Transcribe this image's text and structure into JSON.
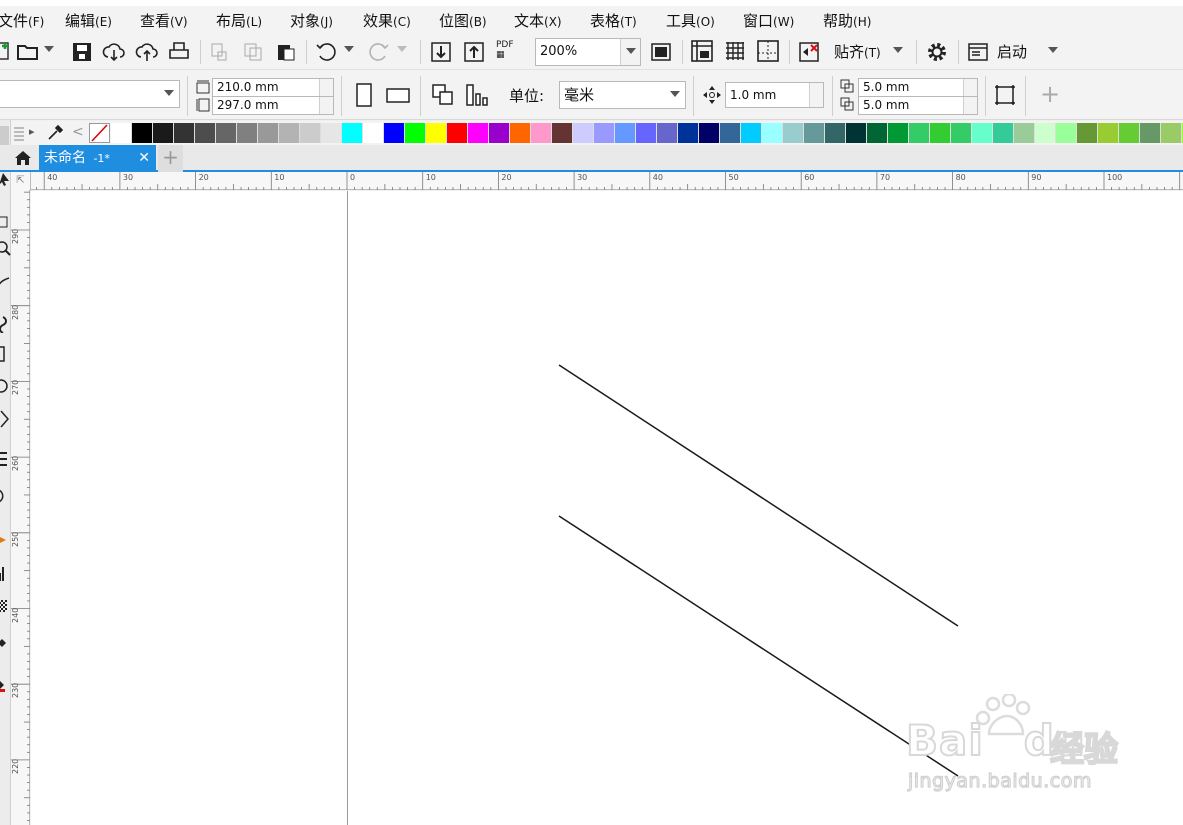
{
  "menu": [
    {
      "label": "文件",
      "hotkey": "(F)"
    },
    {
      "label": "编辑",
      "hotkey": "(E)"
    },
    {
      "label": "查看",
      "hotkey": "(V)"
    },
    {
      "label": "布局",
      "hotkey": "(L)"
    },
    {
      "label": "对象",
      "hotkey": "(J)"
    },
    {
      "label": "效果",
      "hotkey": "(C)"
    },
    {
      "label": "位图",
      "hotkey": "(B)"
    },
    {
      "label": "文本",
      "hotkey": "(X)"
    },
    {
      "label": "表格",
      "hotkey": "(T)"
    },
    {
      "label": "工具",
      "hotkey": "(O)"
    },
    {
      "label": "窗口",
      "hotkey": "(W)"
    },
    {
      "label": "帮助",
      "hotkey": "(H)"
    }
  ],
  "toolbar": {
    "zoom": "200%",
    "snap_label": "贴齐",
    "snap_hotkey": "(T)",
    "launch_label": "启动",
    "pdf_label": "PDF"
  },
  "property_bar": {
    "width": "210.0 mm",
    "height": "297.0 mm",
    "units_label": "单位:",
    "units_value": "毫米",
    "nudge": "1.0 mm",
    "dup_x": "5.0 mm",
    "dup_y": "5.0 mm"
  },
  "palette": [
    "#ffffff",
    "#000000",
    "#1a1a1a",
    "#333333",
    "#4d4d4d",
    "#666666",
    "#808080",
    "#999999",
    "#b3b3b3",
    "#cccccc",
    "#e6e6e6",
    "#00ffff",
    "#ffffff",
    "#0000ff",
    "#00ff00",
    "#ffff00",
    "#ff0000",
    "#ff00ff",
    "#9900cc",
    "#ff6600",
    "#ff99cc",
    "#663333",
    "#ccccff",
    "#9999ff",
    "#6699ff",
    "#6666ff",
    "#6666cc",
    "#003399",
    "#000066",
    "#336699",
    "#00ccff",
    "#99ffff",
    "#99cccc",
    "#669999",
    "#336666",
    "#003333",
    "#006633",
    "#009933",
    "#33cc66",
    "#33cc33",
    "#33cc66",
    "#66ffcc",
    "#33cc99",
    "#99cc99",
    "#ccffcc",
    "#99ff99",
    "#669933",
    "#99cc33",
    "#66cc33",
    "#669966",
    "#99cc66",
    "#99ff33",
    "#ccff66"
  ],
  "document_tab": {
    "title": "未命名",
    "suffix": "-1*"
  },
  "rulers": {
    "h_labels": [
      "40",
      "30",
      "20",
      "10",
      "0",
      "10",
      "20",
      "30",
      "40",
      "50",
      "60",
      "70",
      "80",
      "90",
      "100",
      "110"
    ],
    "v_labels": [
      "290",
      "280",
      "270",
      "260",
      "250",
      "240",
      "230",
      "220"
    ]
  },
  "watermark": {
    "brand": "Bai",
    "brand2": "du",
    "brand_cn": "经验",
    "url": "jingyan.baidu.com"
  }
}
